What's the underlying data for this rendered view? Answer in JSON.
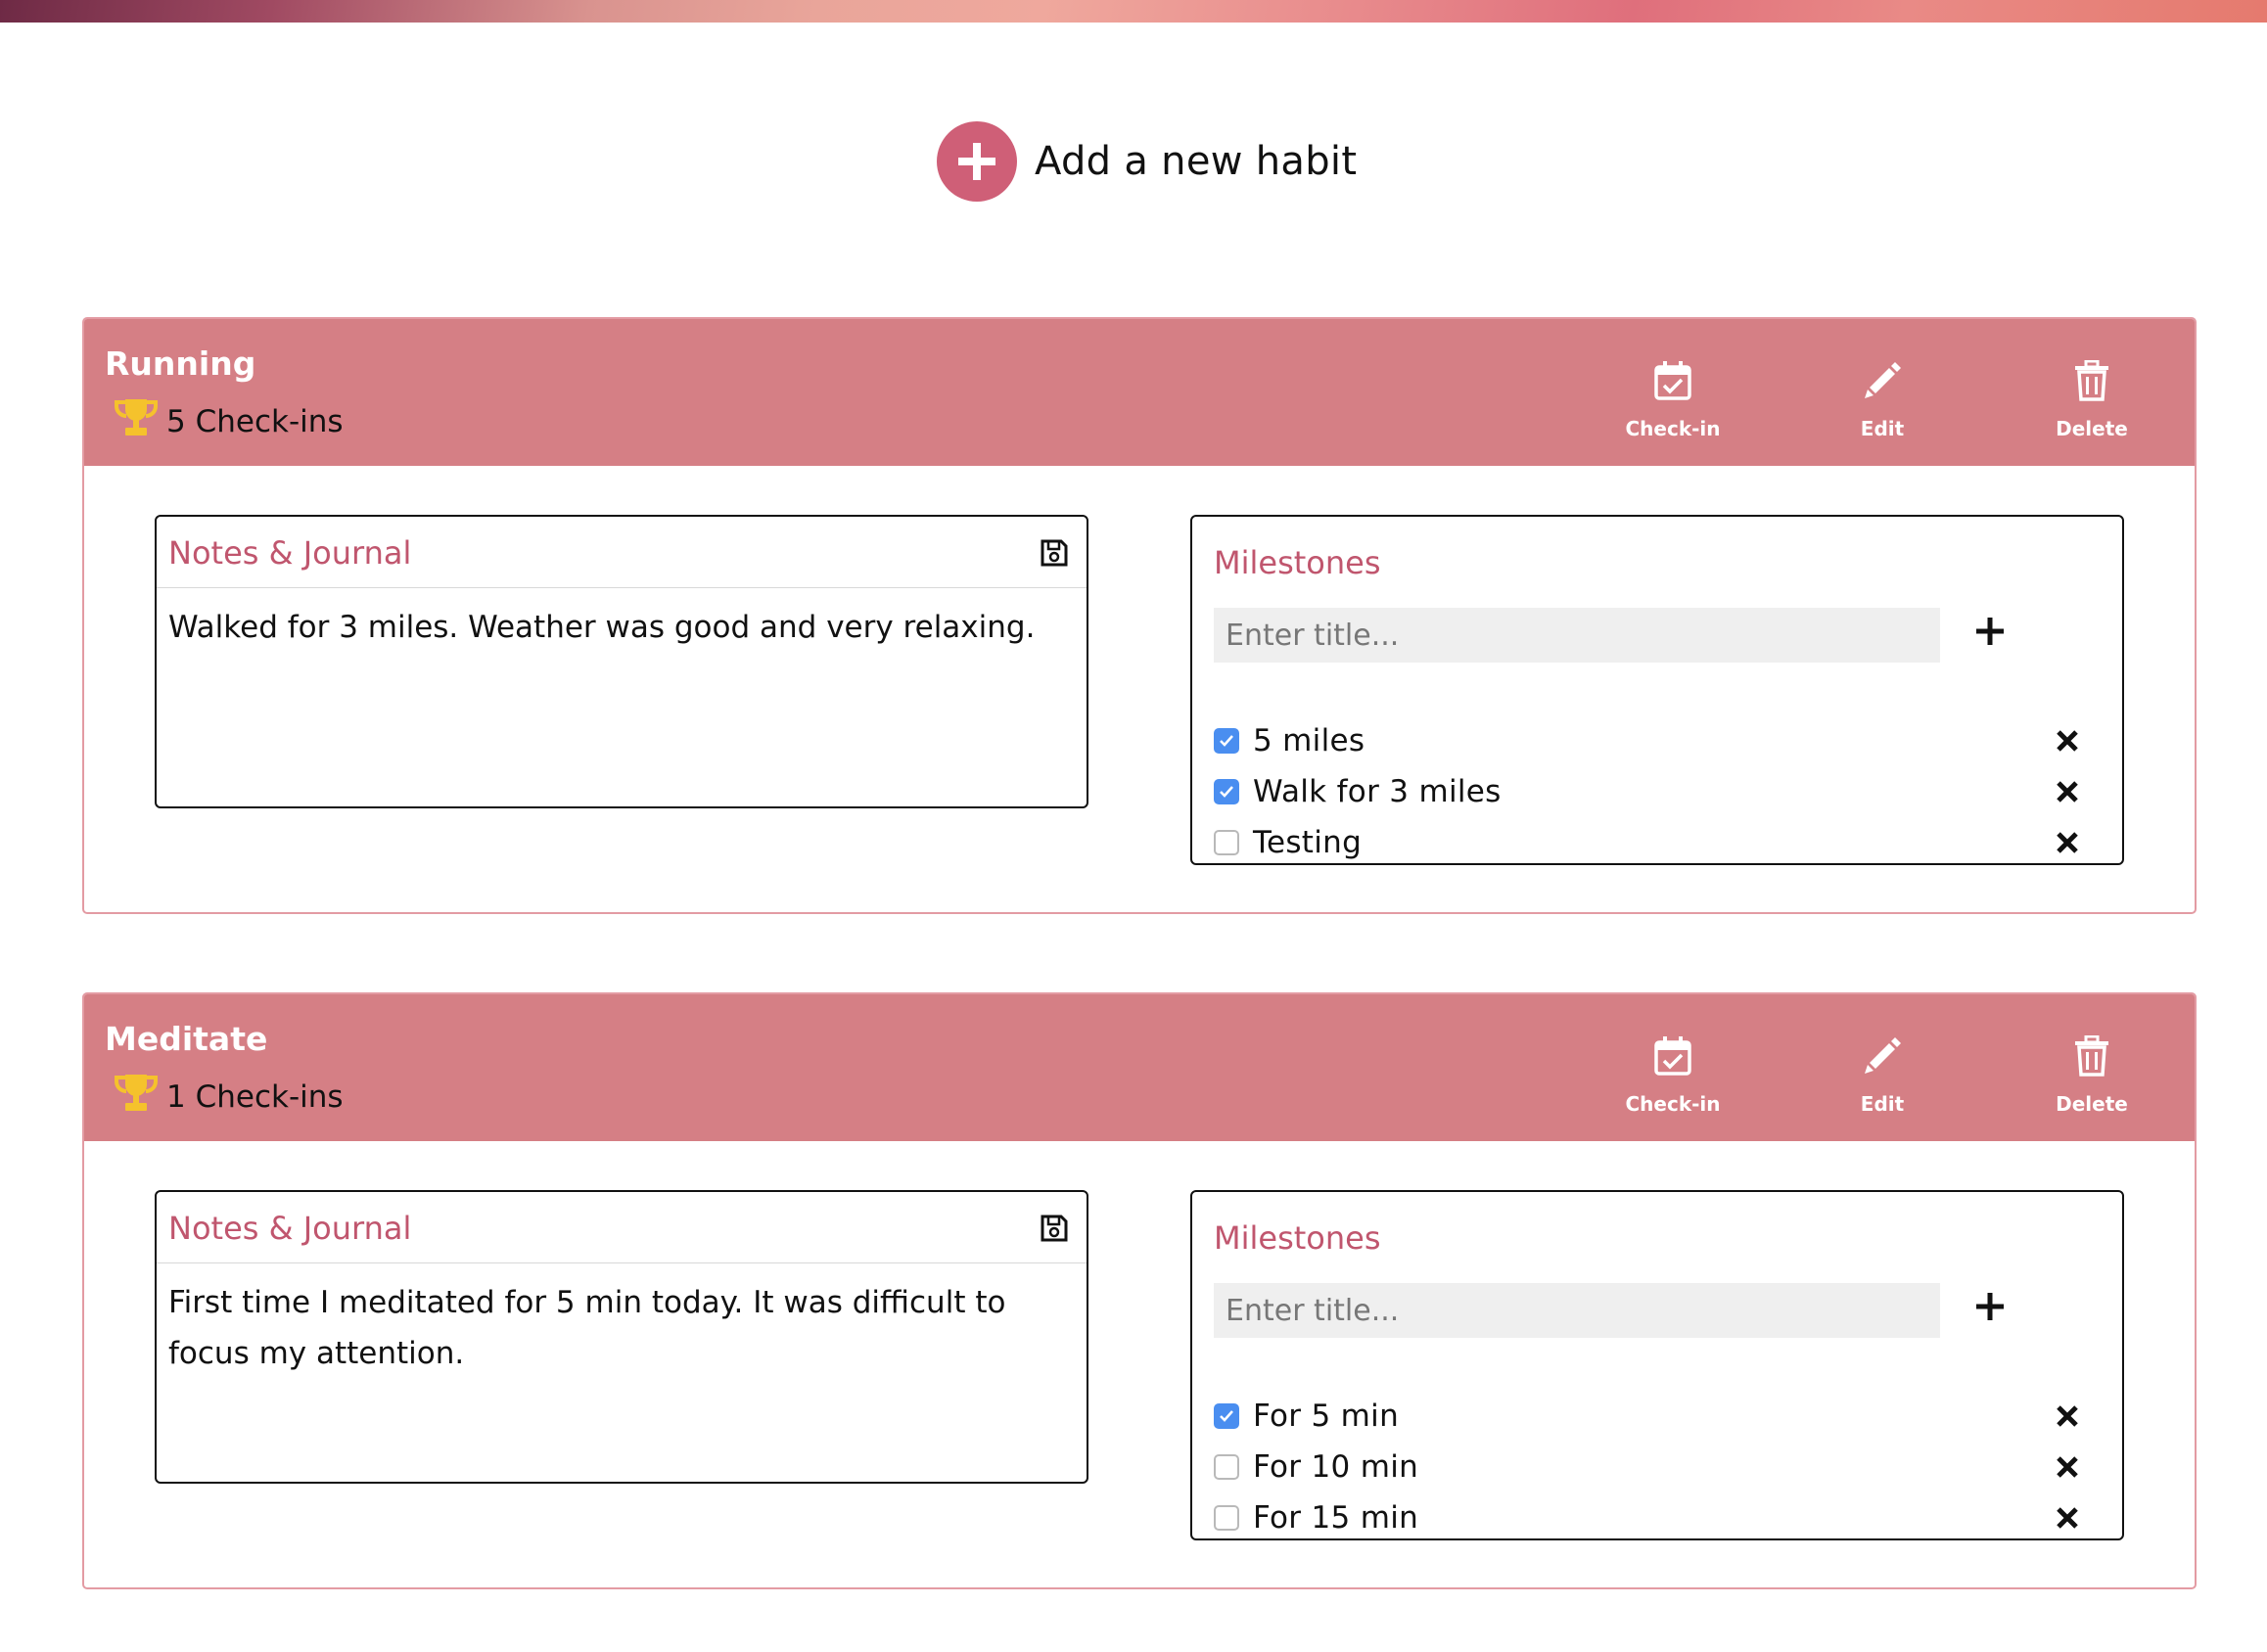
{
  "add_habit": {
    "label": "Add a new habit"
  },
  "colors": {
    "accent": "#cf5f77",
    "header": "#d57f85",
    "title_text": "#c0566e",
    "check": "#4a8ef0",
    "trophy": "#f5c22c"
  },
  "actions": {
    "checkin": "Check-in",
    "edit": "Edit",
    "delete": "Delete"
  },
  "habits": [
    {
      "title": "Running",
      "checkins": "5 Check-ins",
      "notes_title": "Notes & Journal",
      "notes_text": "Walked for 3 miles. Weather was good and very relaxing.",
      "milestones_title": "Milestones",
      "input_placeholder": "Enter title...",
      "milestones": [
        {
          "label": "5 miles",
          "checked": true
        },
        {
          "label": "Walk for 3 miles",
          "checked": true
        },
        {
          "label": "Testing",
          "checked": false
        }
      ]
    },
    {
      "title": "Meditate",
      "checkins": "1 Check-ins",
      "notes_title": "Notes & Journal",
      "notes_text": "First time I meditated for 5 min today. It was difficult to focus my attention.",
      "milestones_title": "Milestones",
      "input_placeholder": "Enter title...",
      "milestones": [
        {
          "label": "For 5 min",
          "checked": true
        },
        {
          "label": "For 10 min",
          "checked": false
        },
        {
          "label": "For 15 min",
          "checked": false
        }
      ]
    }
  ]
}
